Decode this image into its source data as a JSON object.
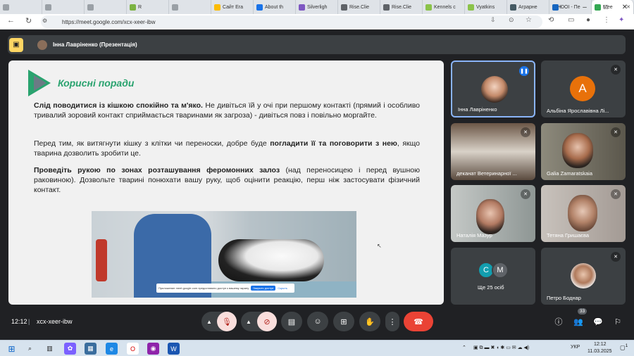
{
  "tabs": [
    {
      "label": "",
      "fav": "#9aa0a6"
    },
    {
      "label": "",
      "fav": "#9aa0a6"
    },
    {
      "label": "",
      "fav": "#9aa0a6"
    },
    {
      "label": "R",
      "fav": "#7cb342"
    },
    {
      "label": "",
      "fav": "#9aa0a6"
    },
    {
      "label": "Сайт Era",
      "fav": "#fbbc04"
    },
    {
      "label": "About th",
      "fav": "#1a73e8"
    },
    {
      "label": "Silverligh",
      "fav": "#7e57c2"
    },
    {
      "label": "Rise.Clie",
      "fav": "#5f6368"
    },
    {
      "label": "Rise.Clie",
      "fav": "#5f6368"
    },
    {
      "label": "Kennels c",
      "fav": "#8bc34a"
    },
    {
      "label": "Vyatkins",
      "fav": "#8bc34a"
    },
    {
      "label": "Аграрне",
      "fav": "#455a64"
    },
    {
      "label": "DOI - Пе",
      "fav": "#1565c0"
    },
    {
      "label": "Mee",
      "fav": "#34a853",
      "active": true
    }
  ],
  "window_controls": [
    "–",
    "□",
    "✕"
  ],
  "address": {
    "url": "https://meet.google.com/xcx-xeer-ibw"
  },
  "pin": {
    "presenter": "Інна Лавріненко (Презентація)"
  },
  "slide": {
    "title": "Корисні поради",
    "p1_bold": "Слід поводитися із кішкою спокійно та м'яко.",
    "p1_rest": " Не дивіться їй у очі при першому контакті (прямий і особливо тривалий зоровий контакт сприймається тваринами як загроза) - дивіться повз і повільно моргайте.",
    "p2_a": "Перед тим, як витягнути кішку з клітки чи переноски, добре буде ",
    "p2_bold": "погладити її та поговорити з нею",
    "p2_b": ", якщо тварина дозволить зробити це.",
    "p3_bold": "Проведіть рукою по зонах розташування феромонних залоз",
    "p3_rest": " (над переносицею і перед вушною раковиною). Дозвольте тварині понюхати вашу руку, щоб оцінити реакцію, перш ніж застосувати фізичний контакт.",
    "toast_text": "Приложение meet.google.com предоставило доступ к вашему экрану",
    "toast_btn": "Закрыть доступ",
    "toast_hide": "Скрыть"
  },
  "participants": [
    {
      "name": "Інна Лавріненко",
      "bg": "#3c4043",
      "speaking": true
    },
    {
      "name": "Альбіна Ярославівна Лі...",
      "bg": "#3c4043",
      "initial": "A",
      "avatar_color": "#e8710a"
    },
    {
      "name": "деканат Ветеринарної ...",
      "bg": "#5a4a3e"
    },
    {
      "name": "Galia Zamaratskaia",
      "bg": "#6f6a5c"
    },
    {
      "name": "Наталія Мазур",
      "bg": "#9aa1a0"
    },
    {
      "name": "Тетяна Гришаєва",
      "bg": "#b3aca6"
    },
    {
      "name": "Ще 25 осіб",
      "bg": "#3c4043",
      "initials": [
        "C",
        "M"
      ]
    },
    {
      "name": "Петро Боднар",
      "bg": "#3c4043"
    }
  ],
  "bottom": {
    "time": "12:12",
    "meeting_code": "xcx-xeer-ibw",
    "people_count": "33"
  },
  "taskbar": {
    "lang": "УКР",
    "time": "12:12",
    "date": "11.03.2025",
    "notif": "1"
  }
}
